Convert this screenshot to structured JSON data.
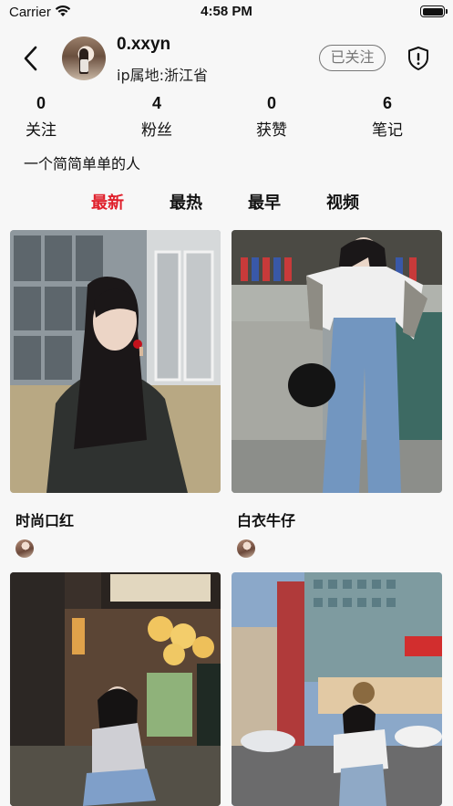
{
  "status_bar": {
    "carrier": "Carrier",
    "time": "4:58 PM"
  },
  "profile": {
    "username": "0.xxyn",
    "ip_location": "ip属地:浙江省",
    "follow_label": "已关注",
    "bio": "一个简简单单的人"
  },
  "stats": [
    {
      "value": "0",
      "label": "关注"
    },
    {
      "value": "4",
      "label": "粉丝"
    },
    {
      "value": "0",
      "label": "获赞"
    },
    {
      "value": "6",
      "label": "笔记"
    }
  ],
  "tabs": [
    {
      "label": "最新",
      "active": true
    },
    {
      "label": "最热",
      "active": false
    },
    {
      "label": "最早",
      "active": false
    },
    {
      "label": "视频",
      "active": false
    }
  ],
  "posts": [
    {
      "title": "时尚口红"
    },
    {
      "title": "白衣牛仔"
    },
    {
      "title": ""
    },
    {
      "title": ""
    }
  ],
  "icons": {
    "back": "chevron-left-icon",
    "report": "shield-exclamation-icon",
    "wifi": "wifi-icon",
    "battery": "battery-icon"
  },
  "colors": {
    "active_tab": "#e0202c",
    "follow_border": "#777777"
  }
}
